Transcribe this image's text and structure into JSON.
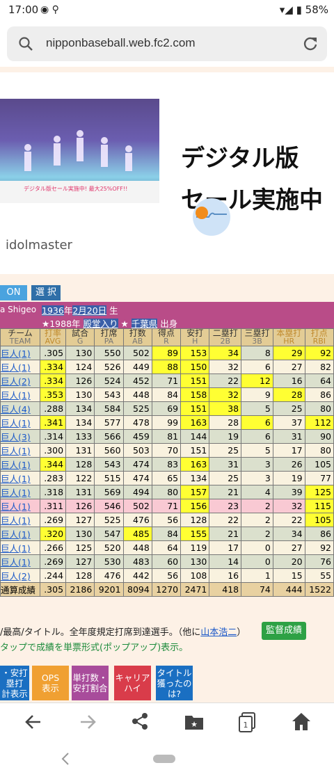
{
  "status": {
    "time": "17:00",
    "battery": "58%"
  },
  "browser": {
    "url": "nipponbaseball.web.fc2.com"
  },
  "ad": {
    "headline_1": "デジタル版",
    "headline_2": "セール実施中",
    "brand": "idolmaster",
    "image_caption": "デジタル版セール実施中! 最大25%OFF!!"
  },
  "controls": {
    "on_label": "ON",
    "select_label": "選 択"
  },
  "player": {
    "name_fragment": "a Shigeo",
    "birth_year": "1936",
    "birth_year_suffix": "年",
    "birth_date": "2月20日",
    "birth_suffix": "生",
    "hof_text": "★1988年",
    "hof_link": "殿堂入り",
    "hof_star": "★",
    "pref": "千葉県",
    "origin_suffix": "出身"
  },
  "table": {
    "headers": [
      {
        "jp": "チーム",
        "en": "TEAM"
      },
      {
        "jp": "打率",
        "en": "AVG"
      },
      {
        "jp": "試合",
        "en": "G"
      },
      {
        "jp": "打席",
        "en": "PA"
      },
      {
        "jp": "打数",
        "en": "AB"
      },
      {
        "jp": "得点",
        "en": "R"
      },
      {
        "jp": "安打",
        "en": "H"
      },
      {
        "jp": "二塁打",
        "en": "2B"
      },
      {
        "jp": "三塁打",
        "en": "3B"
      },
      {
        "jp": "本塁打",
        "en": "HR"
      },
      {
        "jp": "打点",
        "en": "RBI"
      }
    ],
    "rows": [
      {
        "team": "巨人(1)",
        "avg": ".305",
        "g": "130",
        "pa": "550",
        "ab": "502",
        "r": "89",
        "h": "153",
        "b2": "34",
        "b3": "8",
        "hr": "29",
        "rbi": "92",
        "style": "g",
        "hl": [
          "r",
          "h",
          "b2",
          "hr",
          "rbi"
        ]
      },
      {
        "team": "巨人(1)",
        "avg": ".334",
        "g": "124",
        "pa": "526",
        "ab": "449",
        "r": "88",
        "h": "150",
        "b2": "32",
        "b3": "6",
        "hr": "27",
        "rbi": "82",
        "style": "c",
        "hl": [
          "avg",
          "r",
          "h"
        ]
      },
      {
        "team": "巨人(2)",
        "avg": ".334",
        "g": "126",
        "pa": "524",
        "ab": "452",
        "r": "71",
        "h": "151",
        "b2": "22",
        "b3": "12",
        "hr": "16",
        "rbi": "64",
        "style": "g",
        "hl": [
          "avg",
          "h",
          "b3"
        ]
      },
      {
        "team": "巨人(1)",
        "avg": ".353",
        "g": "130",
        "pa": "543",
        "ab": "448",
        "r": "84",
        "h": "158",
        "b2": "32",
        "b3": "9",
        "hr": "28",
        "rbi": "86",
        "style": "c",
        "hl": [
          "avg",
          "h",
          "b2",
          "hr"
        ]
      },
      {
        "team": "巨人(4)",
        "avg": ".288",
        "g": "134",
        "pa": "584",
        "ab": "525",
        "r": "69",
        "h": "151",
        "b2": "38",
        "b3": "5",
        "hr": "25",
        "rbi": "80",
        "style": "g",
        "hl": [
          "h",
          "b2"
        ]
      },
      {
        "team": "巨人(1)",
        "avg": ".341",
        "g": "134",
        "pa": "577",
        "ab": "478",
        "r": "99",
        "h": "163",
        "b2": "28",
        "b3": "6",
        "hr": "37",
        "rbi": "112",
        "style": "c",
        "hl": [
          "avg",
          "h",
          "b3",
          "rbi"
        ]
      },
      {
        "team": "巨人(3)",
        "avg": ".314",
        "g": "133",
        "pa": "566",
        "ab": "459",
        "r": "81",
        "h": "144",
        "b2": "19",
        "b3": "6",
        "hr": "31",
        "rbi": "90",
        "style": "g",
        "hl": []
      },
      {
        "team": "巨人(1)",
        "avg": ".300",
        "g": "131",
        "pa": "560",
        "ab": "503",
        "r": "70",
        "h": "151",
        "b2": "25",
        "b3": "5",
        "hr": "17",
        "rbi": "80",
        "style": "c",
        "hl": []
      },
      {
        "team": "巨人(1)",
        "avg": ".344",
        "g": "128",
        "pa": "543",
        "ab": "474",
        "r": "83",
        "h": "163",
        "b2": "31",
        "b3": "3",
        "hr": "26",
        "rbi": "105",
        "style": "g",
        "hl": [
          "avg",
          "h"
        ]
      },
      {
        "team": "巨人(1)",
        "avg": ".283",
        "g": "122",
        "pa": "515",
        "ab": "474",
        "r": "65",
        "h": "134",
        "b2": "25",
        "b3": "3",
        "hr": "19",
        "rbi": "77",
        "style": "c",
        "hl": []
      },
      {
        "team": "巨人(1)",
        "avg": ".318",
        "g": "131",
        "pa": "569",
        "ab": "494",
        "r": "80",
        "h": "157",
        "b2": "21",
        "b3": "4",
        "hr": "39",
        "rbi": "125",
        "style": "g",
        "hl": [
          "h",
          "rbi"
        ]
      },
      {
        "team": "巨人(1)",
        "avg": ".311",
        "g": "126",
        "pa": "546",
        "ab": "502",
        "r": "71",
        "h": "156",
        "b2": "23",
        "b3": "2",
        "hr": "32",
        "rbi": "115",
        "style": "p",
        "hl": [
          "h",
          "rbi"
        ]
      },
      {
        "team": "巨人(1)",
        "avg": ".269",
        "g": "127",
        "pa": "525",
        "ab": "476",
        "r": "56",
        "h": "128",
        "b2": "22",
        "b3": "2",
        "hr": "22",
        "rbi": "105",
        "style": "c",
        "hl": [
          "rbi"
        ]
      },
      {
        "team": "巨人(1)",
        "avg": ".320",
        "g": "130",
        "pa": "547",
        "ab": "485",
        "r": "84",
        "h": "155",
        "b2": "21",
        "b3": "2",
        "hr": "34",
        "rbi": "86",
        "style": "g",
        "hl": [
          "avg",
          "ab",
          "h"
        ]
      },
      {
        "team": "巨人(1)",
        "avg": ".266",
        "g": "125",
        "pa": "520",
        "ab": "448",
        "r": "64",
        "h": "119",
        "b2": "17",
        "b3": "0",
        "hr": "27",
        "rbi": "92",
        "style": "c",
        "hl": []
      },
      {
        "team": "巨人(1)",
        "avg": ".269",
        "g": "127",
        "pa": "530",
        "ab": "483",
        "r": "60",
        "h": "130",
        "b2": "14",
        "b3": "0",
        "hr": "20",
        "rbi": "76",
        "style": "g",
        "hl": []
      },
      {
        "team": "巨人(2)",
        "avg": ".244",
        "g": "128",
        "pa": "476",
        "ab": "442",
        "r": "56",
        "h": "108",
        "b2": "16",
        "b3": "1",
        "hr": "15",
        "rbi": "55",
        "style": "c",
        "hl": []
      }
    ],
    "total": {
      "team": "通算成績",
      "avg": ".305",
      "g": "2186",
      "pa": "9201",
      "ab": "8094",
      "r": "1270",
      "h": "2471",
      "b2": "418",
      "b3": "74",
      "hr": "444",
      "rbi": "1522"
    }
  },
  "notes": {
    "line1_pre": "/最高/タイトル。全年度規定打席到達選手。（他に",
    "line1_link": "山本浩二",
    "line1_post": "）",
    "line2": "タップで成績を単票形式(ポップアップ)表示。",
    "manager_button": "監督成績"
  },
  "tiles": [
    {
      "label": "・安打\n塁打\n計表示",
      "color": "#1a6fc2"
    },
    {
      "label": "OPS\n表示",
      "color": "#f0a032"
    },
    {
      "label": "単打数・\n安打割合",
      "color": "#a84c9b"
    },
    {
      "label": "キャリア\nハイ",
      "color": "#d93c4a"
    },
    {
      "label": "タイトル\n獲ったの\nは?",
      "color": "#1a6fc2"
    }
  ],
  "colors": {
    "highlight": "#ffff33",
    "header": "#e3cc95",
    "infobar": "#b94c88"
  }
}
